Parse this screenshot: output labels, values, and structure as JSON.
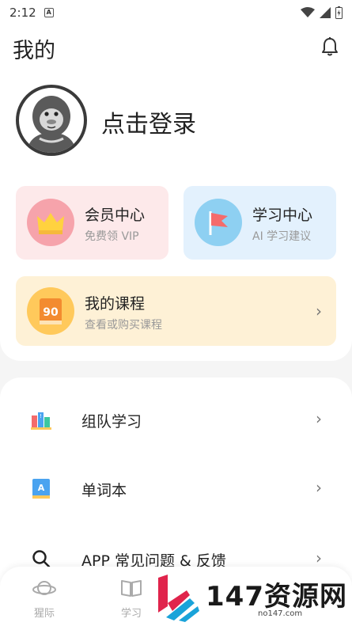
{
  "status_bar": {
    "time": "2:12",
    "a_badge": "A"
  },
  "header": {
    "title": "我的"
  },
  "profile": {
    "login_text": "点击登录"
  },
  "tiles": {
    "vip": {
      "title": "会员中心",
      "subtitle": "免费领 VIP"
    },
    "study": {
      "title": "学习中心",
      "subtitle": "AI 学习建议"
    },
    "course": {
      "title": "我的课程",
      "subtitle": "查看或购买课程",
      "badge": "90"
    }
  },
  "menu": [
    {
      "label": "组队学习",
      "icon": "team-books-icon"
    },
    {
      "label": "单词本",
      "icon": "word-book-icon"
    },
    {
      "label": "APP 常见问题 & 反馈",
      "icon": "search-icon"
    }
  ],
  "bottom_nav": [
    {
      "label": "猩际",
      "icon": "planet-icon"
    },
    {
      "label": "学习",
      "icon": "book-icon"
    }
  ],
  "watermark": {
    "text": "147资源网",
    "sub": "no147.com"
  },
  "colors": {
    "vip_bg": "#fde9ea",
    "study_bg": "#e3f1fd",
    "course_bg": "#fef1d6"
  }
}
